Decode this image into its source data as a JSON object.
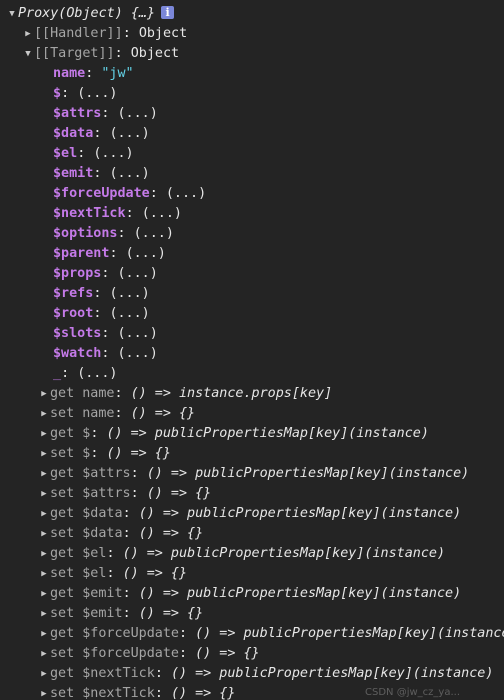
{
  "header": {
    "label": "Proxy(Object) {…}",
    "info_icon": "info-icon"
  },
  "handler": {
    "key": "[[Handler]]",
    "value": "Object"
  },
  "target": {
    "key": "[[Target]]",
    "value": "Object"
  },
  "name_prop": {
    "key": "name",
    "value": "\"jw\""
  },
  "props": [
    "$",
    "$attrs",
    "$data",
    "$el",
    "$emit",
    "$forceUpdate",
    "$nextTick",
    "$options",
    "$parent",
    "$props",
    "$refs",
    "$root",
    "$slots",
    "$watch",
    "_"
  ],
  "lazy_value": "(...)",
  "accessors": [
    {
      "kind": "get",
      "key": "name",
      "value": "() => instance.props[key]"
    },
    {
      "kind": "set",
      "key": "name",
      "value": "() => {}"
    },
    {
      "kind": "get",
      "key": "$",
      "value": "() => publicPropertiesMap[key](instance)"
    },
    {
      "kind": "set",
      "key": "$",
      "value": "() => {}"
    },
    {
      "kind": "get",
      "key": "$attrs",
      "value": "() => publicPropertiesMap[key](instance)"
    },
    {
      "kind": "set",
      "key": "$attrs",
      "value": "() => {}"
    },
    {
      "kind": "get",
      "key": "$data",
      "value": "() => publicPropertiesMap[key](instance)"
    },
    {
      "kind": "set",
      "key": "$data",
      "value": "() => {}"
    },
    {
      "kind": "get",
      "key": "$el",
      "value": "() => publicPropertiesMap[key](instance)"
    },
    {
      "kind": "set",
      "key": "$el",
      "value": "() => {}"
    },
    {
      "kind": "get",
      "key": "$emit",
      "value": "() => publicPropertiesMap[key](instance)"
    },
    {
      "kind": "set",
      "key": "$emit",
      "value": "() => {}"
    },
    {
      "kind": "get",
      "key": "$forceUpdate",
      "value": "() => publicPropertiesMap[key](instance)"
    },
    {
      "kind": "set",
      "key": "$forceUpdate",
      "value": "() => {}"
    },
    {
      "kind": "get",
      "key": "$nextTick",
      "value": "() => publicPropertiesMap[key](instance)"
    },
    {
      "kind": "set",
      "key": "$nextTick",
      "value": "() => {}"
    }
  ],
  "watermark": "CSDN @jw_cz_ya..."
}
